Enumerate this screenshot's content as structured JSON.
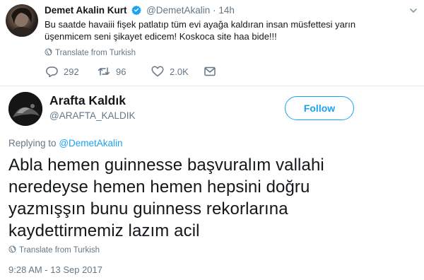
{
  "tweet1": {
    "author_name": "Demet Akalin Kurt",
    "handle": "@DemetAkalin",
    "separator": "·",
    "time": "14h",
    "text_line1": "Bu saatde havaiii fişek patlatıp tüm evi ayağa kaldıran insan müsfettesi yarın",
    "text_line2": "üşenmicem seni şikayet edicem! Koskoca site haa bide!!!",
    "translate_label": "Translate from Turkish",
    "reply_count": "292",
    "retweet_count": "96",
    "like_count": "2.0K"
  },
  "tweet2": {
    "author_name": "Arafta Kaldık",
    "handle": "@ARAFTA_KALDIK",
    "follow_label": "Follow",
    "replying_prefix": "Replying to",
    "replying_to": "@DemetAkalin",
    "text_line1": "Abla hemen guinnesse başvuralım vallahi",
    "text_line2": "neredeyse hemen hemen hepsini doğru",
    "text_line3": "yazmışşın bunu guinness rekorlarına",
    "text_line4": "kaydettirmemiz lazım acil",
    "translate_label": "Translate from Turkish",
    "timestamp": "9:28 AM - 13 Sep 2017"
  },
  "colors": {
    "brand_blue": "#1da1f2",
    "secondary_text": "#657786",
    "primary_text": "#14171a",
    "divider": "#e6ecf0"
  },
  "icons": {
    "more": "chevron-down-icon",
    "verified": "verified-badge-icon",
    "translate": "globe-icon",
    "reply": "reply-icon",
    "retweet": "retweet-icon",
    "like": "heart-icon",
    "dm": "envelope-icon"
  }
}
